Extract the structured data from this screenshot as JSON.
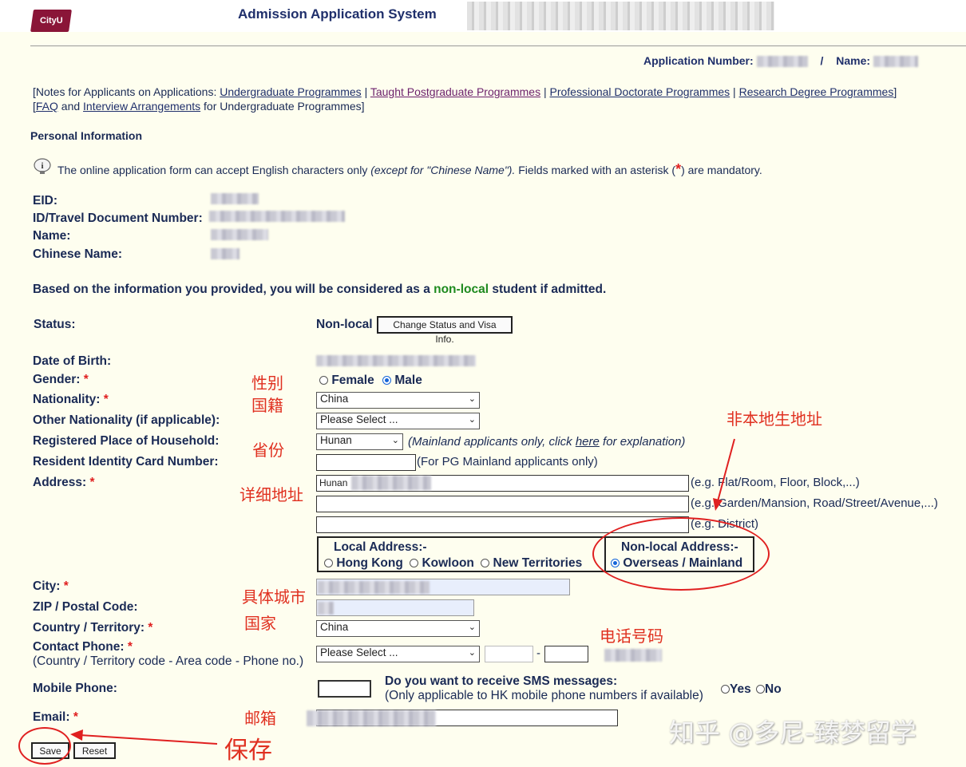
{
  "header": {
    "logo_text": "CityU",
    "system_title": "Admission Application System",
    "application_number_label": "Application Number:",
    "separator": "/",
    "name_label": "Name:"
  },
  "notes": {
    "prefix": "[Notes for Applicants on Applications:",
    "links": [
      "Undergraduate Programmes",
      "Taught Postgraduate Programmes",
      "Professional Doctorate Programmes",
      "Research Degree Programmes"
    ],
    "sep": "|",
    "suffix": "]",
    "line2_open": "[",
    "faq": "FAQ",
    "and": "and",
    "interview": "Interview Arrangements",
    "line2_tail": "for Undergraduate Programmes]"
  },
  "section_title": "Personal Information",
  "info": {
    "text_a": "The online application form can accept English characters only",
    "text_b": "(except for \"Chinese Name\").",
    "text_c": "Fields marked with an asterisk (",
    "text_d": ") are mandatory."
  },
  "identity": {
    "eid": "EID:",
    "id_doc": "ID/Travel Document Number:",
    "name": "Name:",
    "chinese_name": "Chinese Name:"
  },
  "status_msg": {
    "a": "Based on the information you provided, you will be considered as a",
    "b": "non-local",
    "c": "student if admitted."
  },
  "status": {
    "label": "Status:",
    "value": "Non-local",
    "button": "Change Status and Visa Info."
  },
  "form": {
    "dob": "Date of Birth:",
    "gender": "Gender:",
    "gender_female": "Female",
    "gender_male": "Male",
    "nationality": "Nationality:",
    "nationality_value": "China",
    "other_nationality": "Other Nationality (if applicable):",
    "other_nationality_value": "Please Select ...",
    "household": "Registered Place of Household:",
    "household_value": "Hunan",
    "household_hint_a": "(Mainland applicants only, click",
    "household_hint_link": "here",
    "household_hint_b": "for explanation)",
    "resident_id": "Resident Identity Card Number:",
    "resident_id_hint": "(For PG Mainland applicants only)",
    "address": "Address:",
    "address_line1_value": "Hunan",
    "address_hint1": "(e.g. Flat/Room, Floor, Block,...)",
    "address_hint2": "(e.g. Garden/Mansion, Road/Street/Avenue,...)",
    "address_hint3": "(e.g. District)",
    "local_address": "Local Address:-",
    "hong_kong": "Hong Kong",
    "kowloon": "Kowloon",
    "new_territories": "New Territories",
    "nonlocal_address": "Non-local Address:-",
    "overseas": "Overseas / Mainland",
    "city": "City:",
    "zip": "ZIP / Postal Code:",
    "country": "Country / Territory:",
    "country_value": "China",
    "contact_phone": "Contact Phone:",
    "contact_phone_sub": "(Country / Territory code - Area code - Phone no.)",
    "contact_phone_select": "Please Select ...",
    "dash": "-",
    "mobile": "Mobile Phone:",
    "sms_q": "Do you want to receive SMS messages:",
    "sms_sub": "(Only applicable to HK mobile phone numbers if available)",
    "yes": "Yes",
    "no": "No",
    "email": "Email:"
  },
  "buttons": {
    "save": "Save",
    "reset": "Reset"
  },
  "annotations": {
    "gender": "性别",
    "nationality": "国籍",
    "province": "省份",
    "detail_address": "详细地址",
    "nonlocal_birth_address": "非本地生地址",
    "city": "具体城市",
    "country": "国家",
    "phone": "电话号码",
    "email": "邮箱",
    "save": "保存"
  },
  "watermark": "知乎 @多尼-臻梦留学",
  "colors": {
    "page_bg": "#fefeef",
    "label_navy": "#1a2a55",
    "annotation_red": "#e02020",
    "nonlocal_green": "#1e8a1e",
    "logo_maroon": "#8a1538"
  }
}
